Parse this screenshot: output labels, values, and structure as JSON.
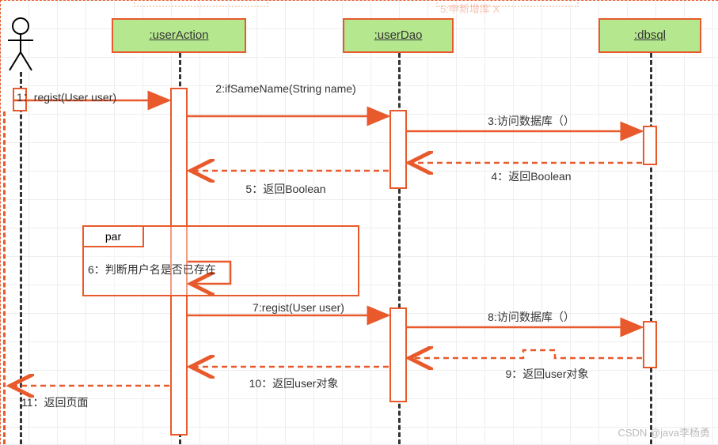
{
  "diagram": {
    "type": "sequence",
    "theme": {
      "lifeline_fill": "#b5e88e",
      "line_color": "#e85a2c"
    }
  },
  "faint": {
    "label": "5:申新增库 X"
  },
  "actor": {
    "name": "Actor"
  },
  "lifelines": {
    "userAction": {
      "label": ":userAction"
    },
    "userDao": {
      "label": ":userDao"
    },
    "dbsql": {
      "label": ":dbsql"
    }
  },
  "messages": {
    "m1": "1：regist(User user)",
    "m2": "2:ifSameName(String name)",
    "m3": "3:访问数据库（）",
    "m4": "4：返回Boolean",
    "m5": "5：返回Boolean",
    "m6": "6：判断用户名是否已存在",
    "m7": "7:regist(User user)",
    "m8": "8:访问数据库（）",
    "m9": "9：返回user对象",
    "m10": "10：返回user对象",
    "m11": "11：返回页面"
  },
  "par": {
    "label": "par"
  },
  "watermark": "CSDN @java李杨勇"
}
